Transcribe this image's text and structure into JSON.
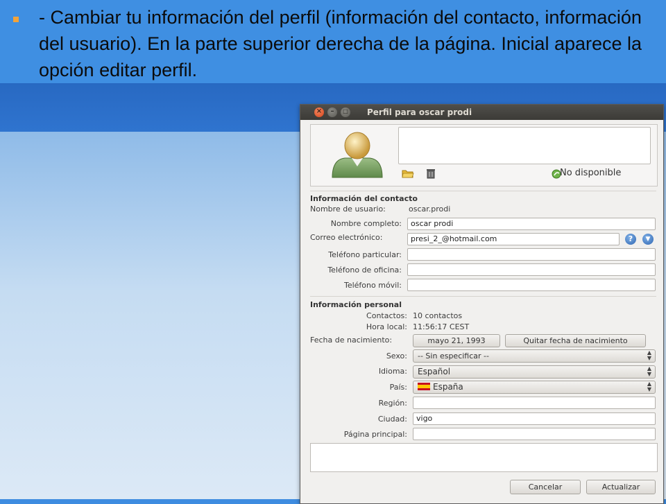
{
  "slide": {
    "bullet_text": "- Cambiar tu información del perfil (información del contacto, información del usuario). En la parte superior derecha de la página. Inicial aparece la opción editar perfil.",
    "bullet_color": "#f2a33a"
  },
  "window": {
    "title": "Perfil para oscar prodi",
    "titlebar_buttons": [
      "close-icon",
      "minimize-icon",
      "maximize-icon"
    ],
    "status_message": "",
    "presence": "No disponible",
    "contact_section": {
      "title": "Información del contacto",
      "username_label": "Nombre de usuario:",
      "username_value": "oscar.prodi",
      "fullname_label": "Nombre completo:",
      "fullname_value": "oscar prodi",
      "email_label": "Correo electrónico:",
      "email_value": "presi_2_@hotmail.com",
      "home_phone_label": "Teléfono particular:",
      "home_phone_value": "",
      "office_phone_label": "Teléfono de oficina:",
      "office_phone_value": "",
      "mobile_label": "Teléfono móvil:",
      "mobile_value": ""
    },
    "personal_section": {
      "title": "Información personal",
      "contacts_label": "Contactos:",
      "contacts_value": "10 contactos",
      "localtime_label": "Hora local:",
      "localtime_value": "11:56:17 CEST",
      "birthdate_label": "Fecha de nacimiento:",
      "birthdate_button": "mayo 21, 1993",
      "clear_birthdate_button": "Quitar fecha de nacimiento",
      "sex_label": "Sexo:",
      "sex_value": "-- Sin especificar --",
      "language_label": "Idioma:",
      "language_value": "Español",
      "country_label": "País:",
      "country_value": "España",
      "region_label": "Región:",
      "region_value": "",
      "city_label": "Ciudad:",
      "city_value": "vigo",
      "homepage_label": "Página principal:",
      "homepage_value": ""
    },
    "cancel_button": "Cancelar",
    "update_button": "Actualizar"
  },
  "colors": {
    "slide_background": "#3f8fe2",
    "titlebar": "#3c3b37",
    "close_button": "#d7431a",
    "window_background": "#f1f0ee"
  }
}
